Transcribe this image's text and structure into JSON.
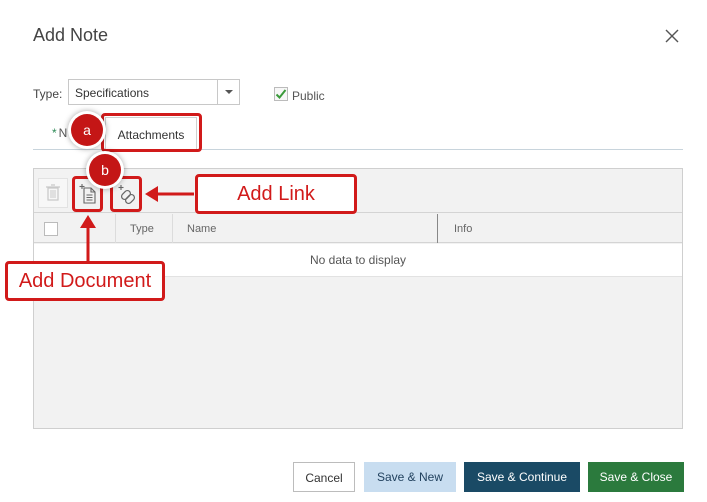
{
  "dialog": {
    "title": "Add Note"
  },
  "form": {
    "type_label": "Type:",
    "type_value": "Specifications",
    "public_label": "Public",
    "public_checked": true
  },
  "tabs": [
    {
      "label": "N",
      "required_marker": "*"
    },
    {
      "label": "Attachments"
    }
  ],
  "toolbar": {
    "delete_icon": "trash-icon",
    "add_document_icon": "add-document-icon",
    "add_link_icon": "add-link-icon"
  },
  "grid": {
    "columns": [
      "Type",
      "Name",
      "Info"
    ],
    "empty_text": "No data to display"
  },
  "buttons": {
    "cancel": "Cancel",
    "save_new": "Save & New",
    "save_continue": "Save & Continue",
    "save_close": "Save & Close"
  },
  "annotations": {
    "badge_a": "a",
    "badge_b": "b",
    "add_link": "Add Link",
    "add_document": "Add Document",
    "color": "#d11a1a"
  }
}
